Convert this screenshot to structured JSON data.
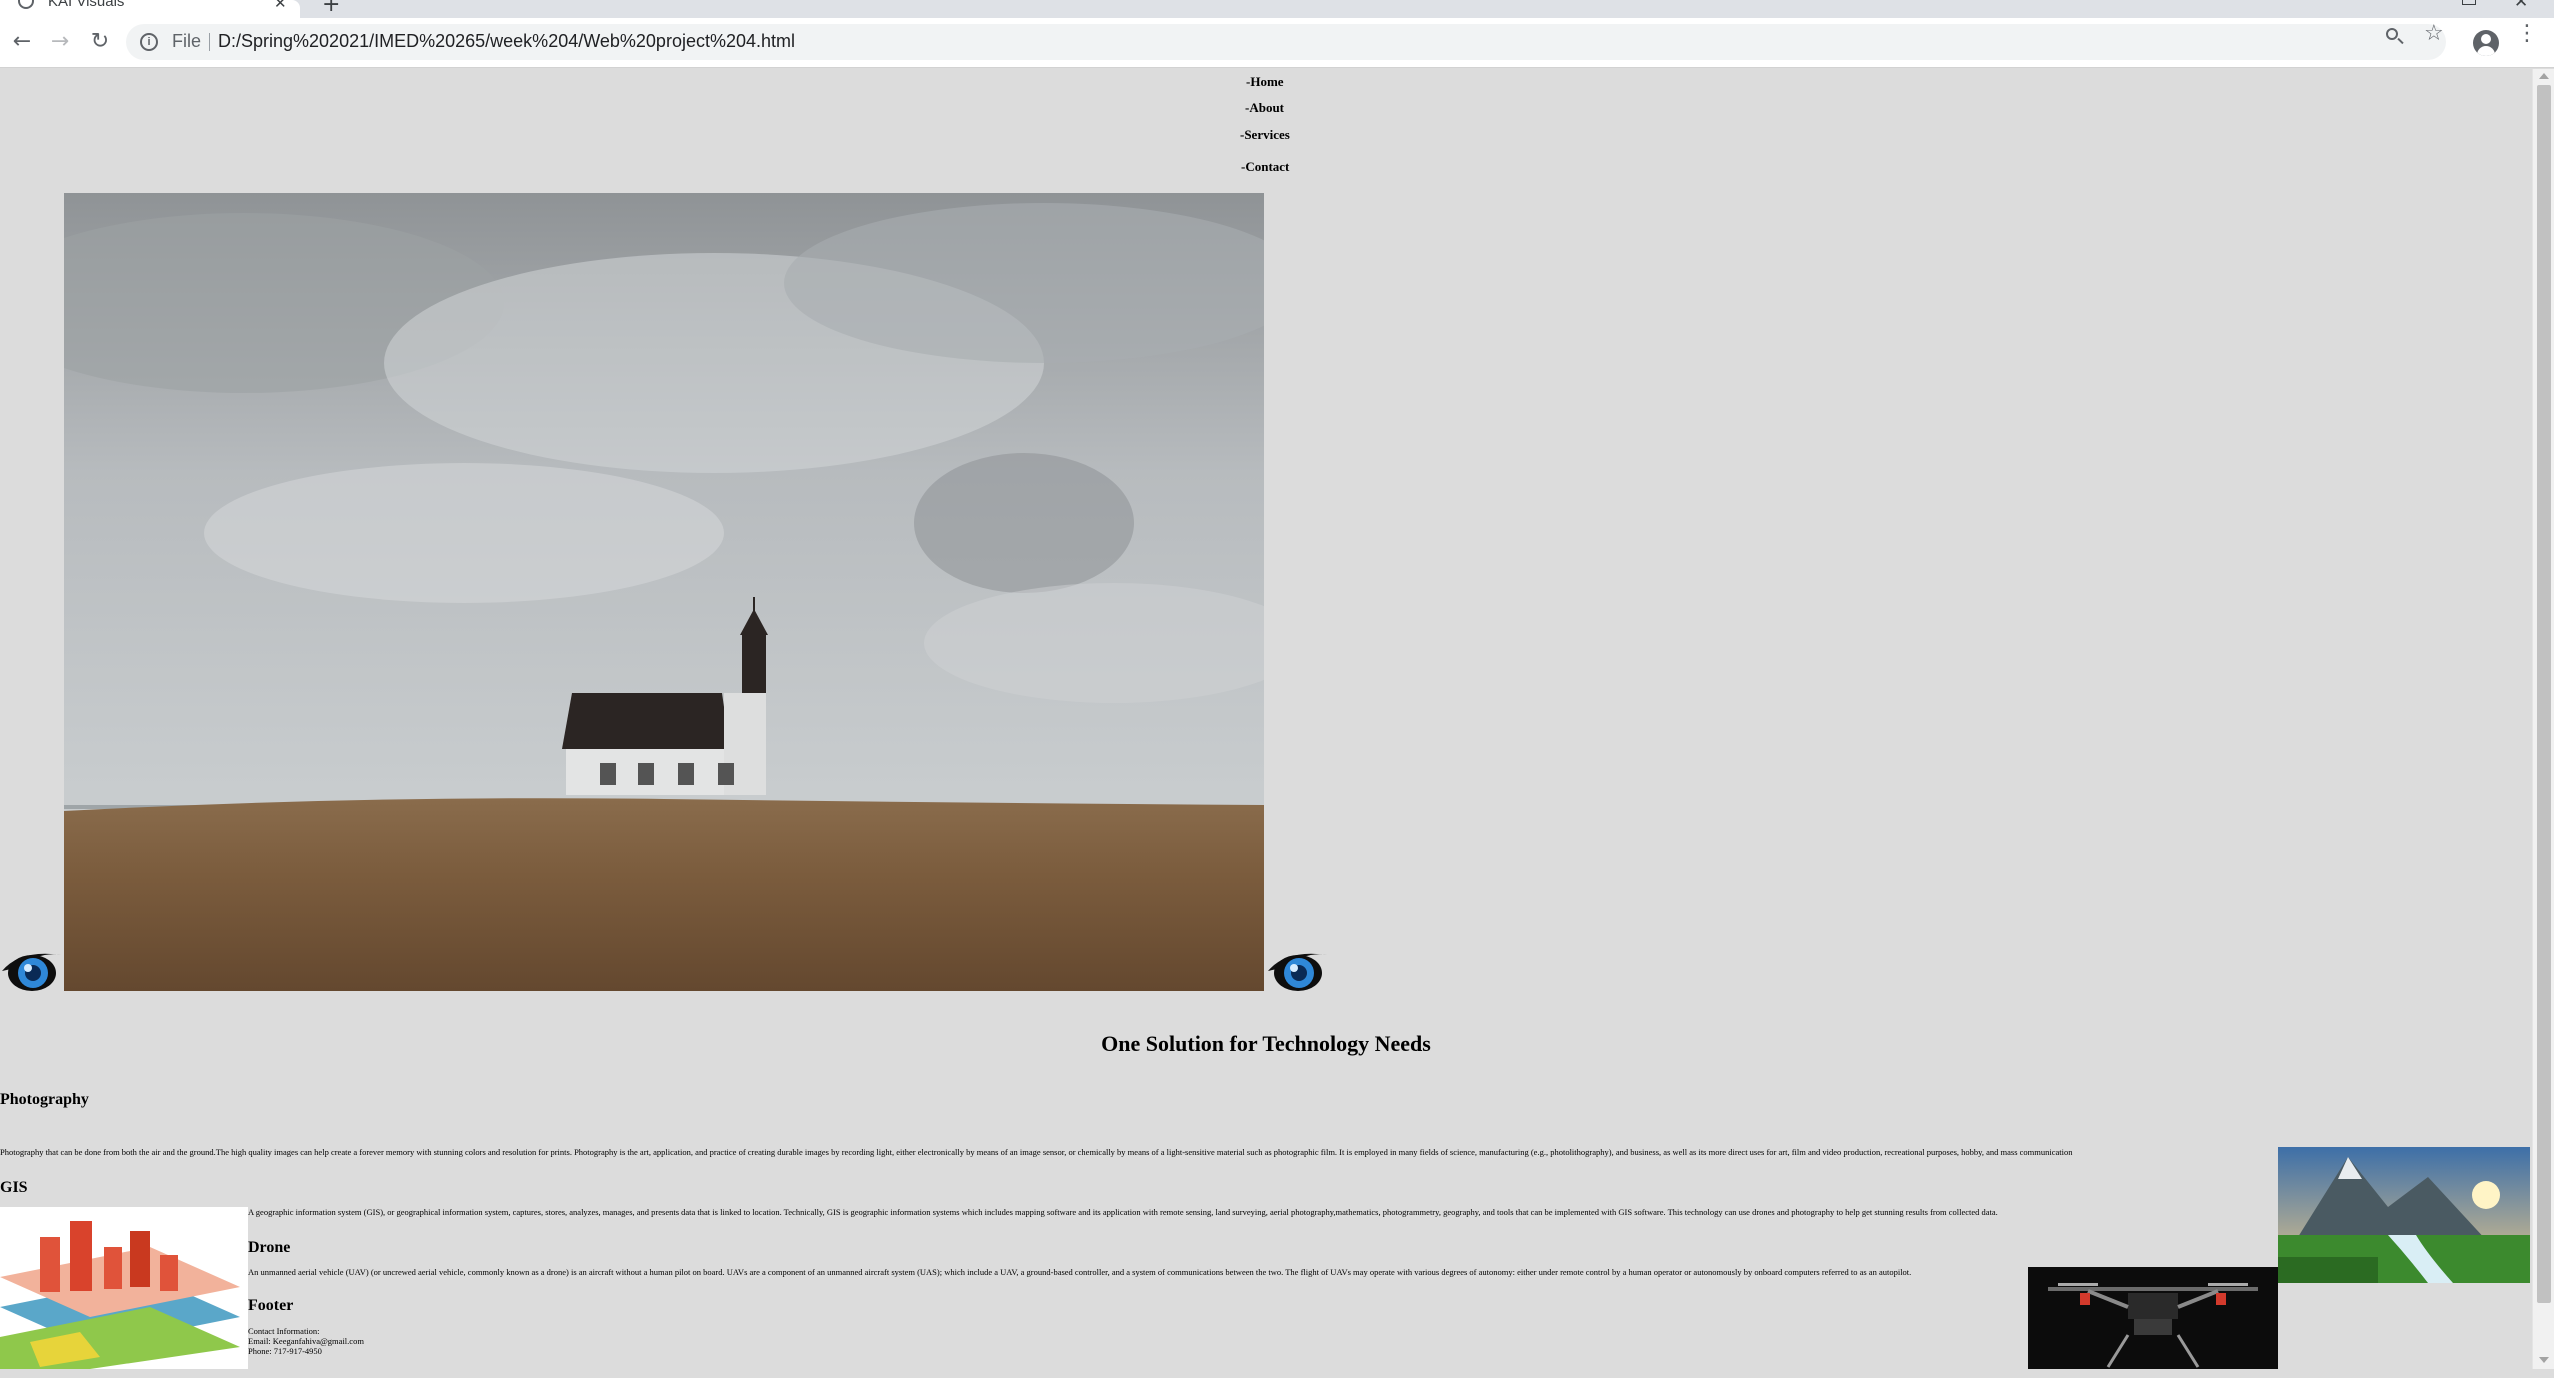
{
  "browser": {
    "tab_title": "KAI Visuals",
    "tab_close": "✕",
    "new_tab": "+",
    "scheme_label": "File",
    "url": "D:/Spring%202021/IMED%20265/week%204/Web%20project%204.html"
  },
  "nav": {
    "items": [
      {
        "label": "-Home"
      },
      {
        "label": "-About"
      },
      {
        "label": "-Services"
      },
      {
        "label": "-Contact"
      }
    ]
  },
  "main": {
    "heading": "One Solution for Technology Needs",
    "photography": {
      "title": "Photography",
      "text": "Photography that can be done from both the air and the ground.The high quality images can help create a forever memory with stunning colors and resolution for prints. Photography is the art, application, and practice of creating durable images by recording light, either electronically by means of an image sensor, or chemically by means of a light-sensitive material such as photographic film. It is employed in many fields of science, manufacturing (e.g., photolithography), and business, as well as its more direct uses for art, film and video production, recreational purposes, hobby, and mass communication"
    },
    "gis": {
      "title": "GIS",
      "text": "A geographic information system (GIS), or geographical information system, captures, stores, analyzes, manages, and presents data that is linked to location. Technically, GIS is geographic information systems which includes mapping software and its application with remote sensing, land surveying, aerial photography,mathematics, photogrammetry, geography, and tools that can be implemented with GIS software. This technology can use drones and photography to help get stunning results from collected data."
    },
    "drone": {
      "title": "Drone",
      "text": "An unmanned aerial vehicle (UAV) (or uncrewed aerial vehicle, commonly known as a drone) is an aircraft without a human pilot on board. UAVs are a component of an unmanned aircraft system (UAS); which include a UAV, a ground-based controller, and a system of communications between the two. The flight of UAVs may operate with various degrees of autonomy: either under remote control by a human operator or autonomously by onboard computers referred to as an autopilot."
    },
    "footer": {
      "title": "Footer",
      "contact_label": "Contact Information:",
      "email": "Email: Keeganfahiva@gmail.com",
      "phone": "Phone: 717-917-4950"
    }
  },
  "icons": {
    "info": "info-icon",
    "zoom": "zoom-icon",
    "star": "star-icon",
    "profile": "profile-icon",
    "menu": "kebab-menu-icon",
    "eye_logo": "eye-logo-icon"
  },
  "colors": {
    "page_background": "#dcdcdc",
    "toolbar_background": "#ffffff",
    "omnibox_background": "#f1f3f4"
  }
}
